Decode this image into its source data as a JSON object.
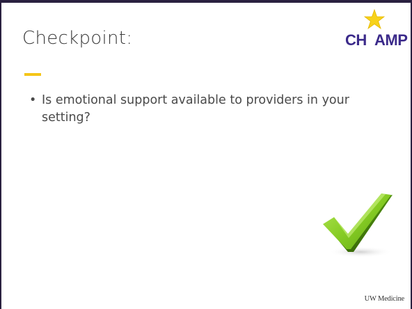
{
  "slide": {
    "title": "Checkpoint:",
    "bullets": [
      "Is emotional support available to providers in your setting?"
    ],
    "bullet_symbol": "•",
    "footer": "UW Medicine",
    "accent_color": "#f5c518",
    "border_color": "#2a2140"
  },
  "logo": {
    "text": "CHAMP",
    "icon": "star-icon",
    "text_color": "#3b2a8a",
    "star_color": "#f7d21a"
  },
  "decoration": {
    "icon": "checkmark-icon",
    "color": "#7cc21e"
  }
}
